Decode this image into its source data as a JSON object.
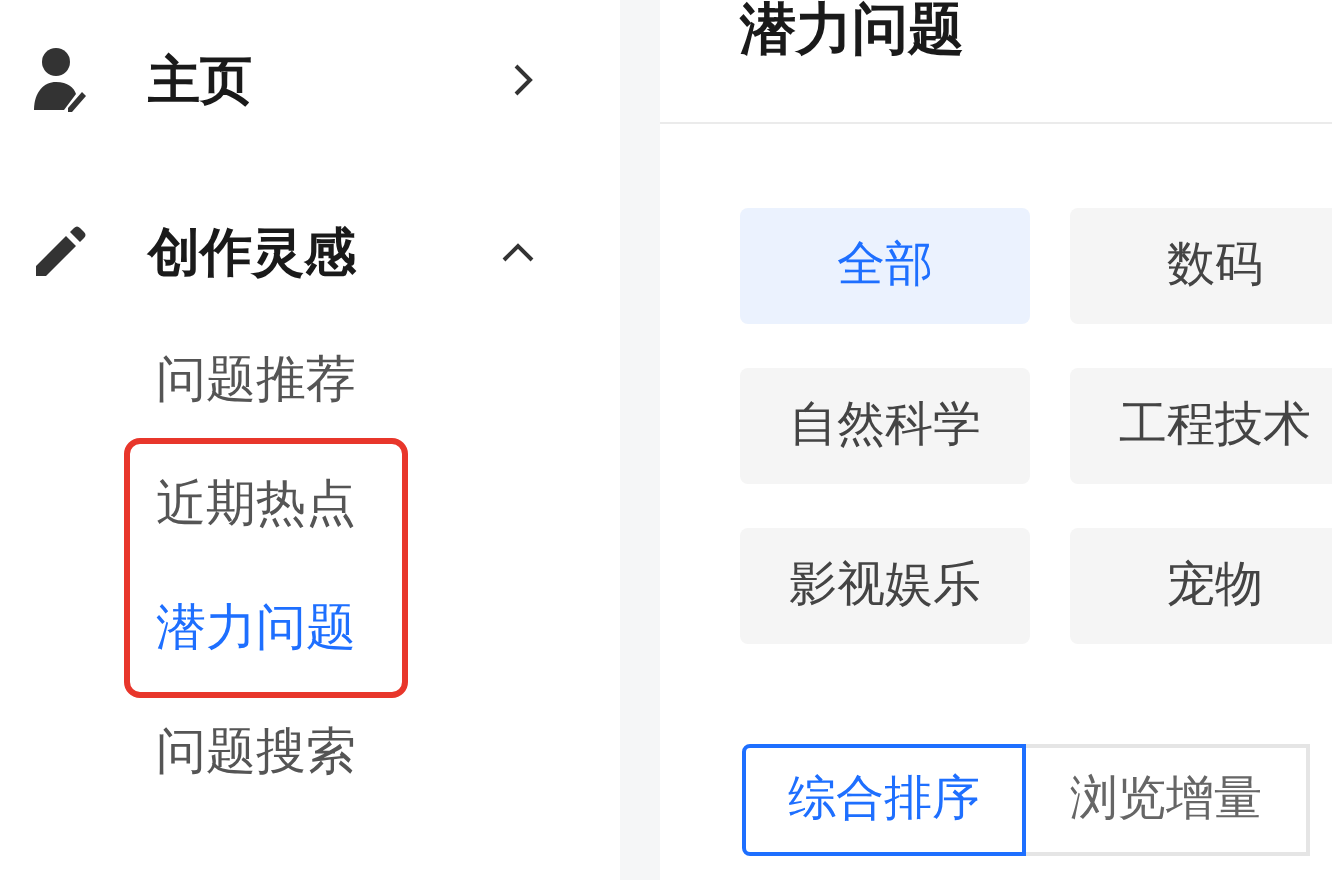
{
  "sidebar": {
    "items": [
      {
        "kind": "home",
        "label": "主页",
        "expanded": false
      },
      {
        "kind": "pen",
        "label": "创作灵感",
        "expanded": true,
        "children": [
          {
            "label": "问题推荐",
            "selected": false,
            "highlighted": false
          },
          {
            "label": "近期热点",
            "selected": false,
            "highlighted": true
          },
          {
            "label": "潜力问题",
            "selected": true,
            "highlighted": true
          },
          {
            "label": "问题搜索",
            "selected": false,
            "highlighted": false
          }
        ]
      }
    ]
  },
  "main": {
    "title": "潜力问题",
    "categories": [
      {
        "label": "全部",
        "selected": true
      },
      {
        "label": "数码",
        "selected": false
      },
      {
        "label": "自然科学",
        "selected": false
      },
      {
        "label": "工程技术",
        "selected": false
      },
      {
        "label": "影视娱乐",
        "selected": false
      },
      {
        "label": "宠物",
        "selected": false
      }
    ],
    "sort_tabs": [
      {
        "label": "综合排序",
        "selected": true
      },
      {
        "label": "浏览增量",
        "selected": false
      }
    ]
  }
}
